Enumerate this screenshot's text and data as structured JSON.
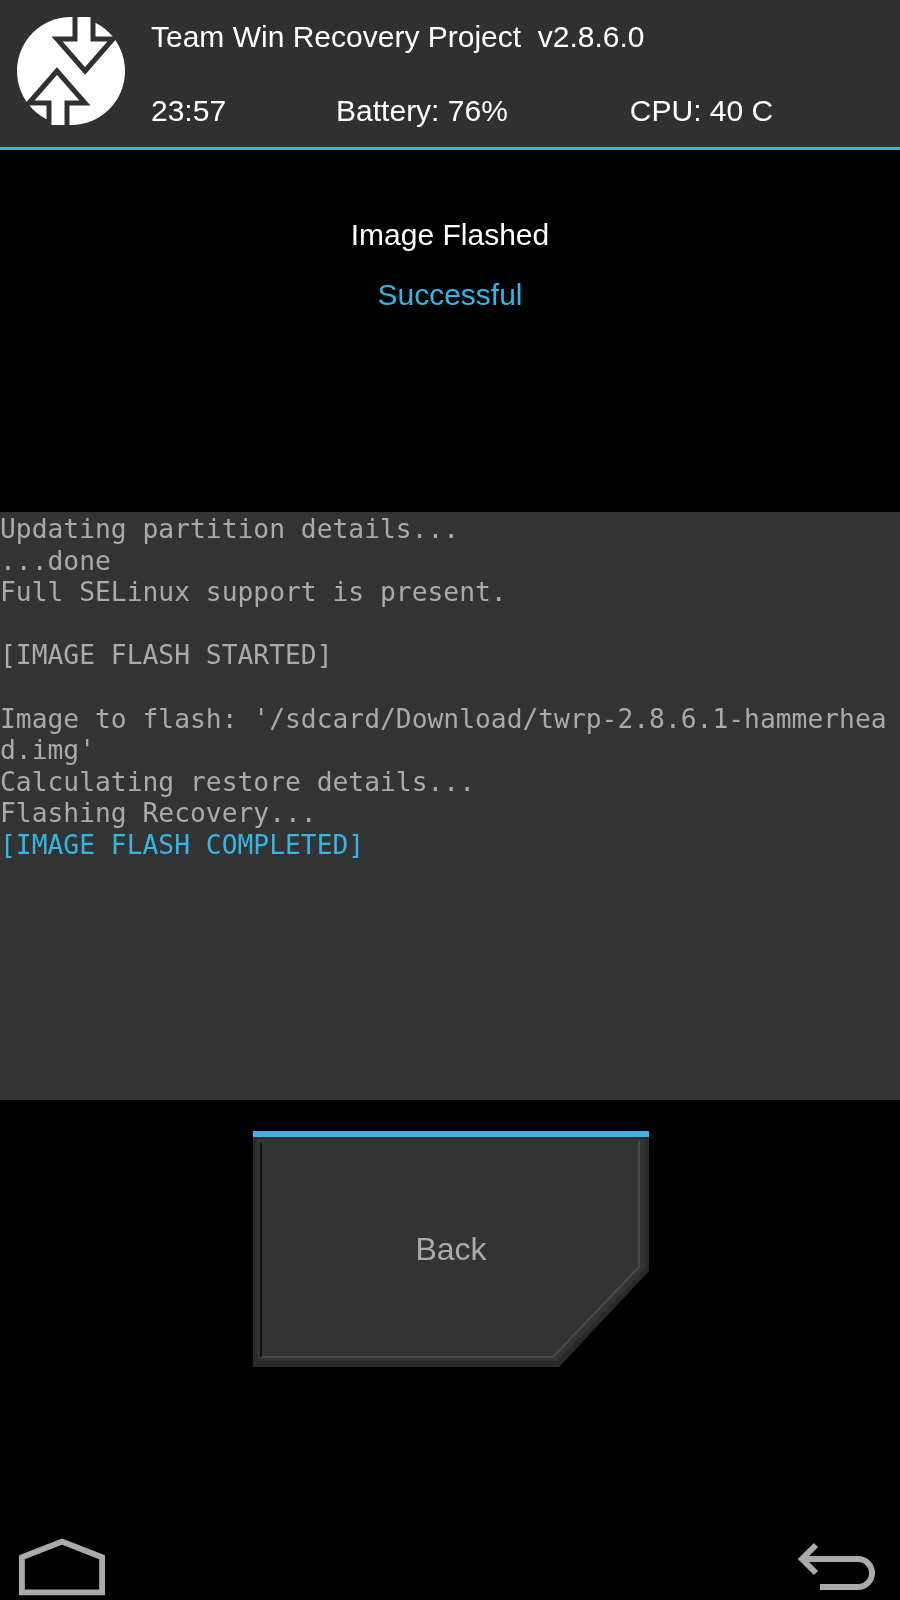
{
  "header": {
    "title": "Team Win Recovery Project  v2.8.6.0",
    "time": "23:57",
    "battery": "Battery: 76%",
    "cpu": "CPU: 40 C"
  },
  "result": {
    "heading": "Image Flashed",
    "status": "Successful"
  },
  "console": [
    {
      "text": "Updating partition details...",
      "kind": "normal",
      "gap_before": false
    },
    {
      "text": "...done",
      "kind": "normal",
      "gap_before": false
    },
    {
      "text": "Full SELinux support is present.",
      "kind": "normal",
      "gap_before": false
    },
    {
      "text": "[IMAGE FLASH STARTED]",
      "kind": "normal",
      "gap_before": true
    },
    {
      "text": "Image to flash: '/sdcard/Download/twrp-2.8.6.1-hammerhead.img'",
      "kind": "normal",
      "gap_before": true
    },
    {
      "text": "Calculating restore details...",
      "kind": "normal",
      "gap_before": false
    },
    {
      "text": "Flashing Recovery...",
      "kind": "normal",
      "gap_before": false
    },
    {
      "text": "[IMAGE FLASH COMPLETED]",
      "kind": "highlight",
      "gap_before": false
    }
  ],
  "button": {
    "label": "Back"
  }
}
